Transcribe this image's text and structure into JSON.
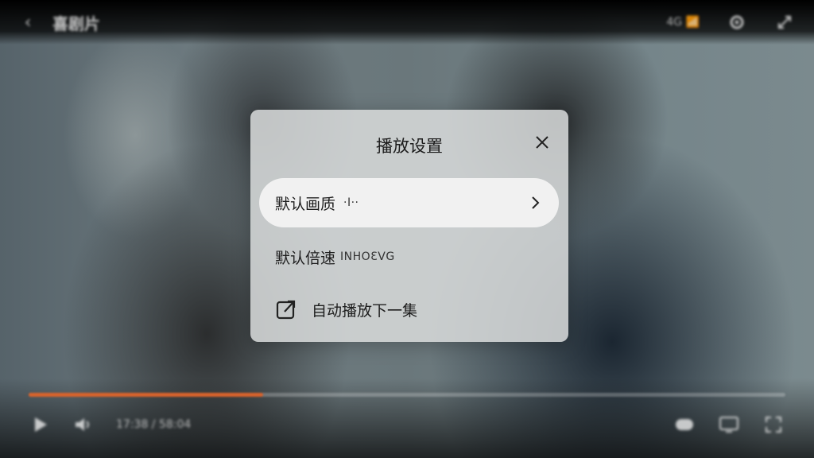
{
  "top_bar": {
    "title": "喜剧片",
    "status_text": "4G 📶"
  },
  "progress": {
    "played_fraction": 0.31
  },
  "controls": {
    "time_text": "17:38 / 58:04"
  },
  "dialog": {
    "title": "播放设置",
    "options": [
      {
        "label": "默认画质",
        "value": "·I··"
      },
      {
        "label": "默认倍速",
        "value": "INHOƐVG"
      },
      {
        "label": "自动播放下一集"
      }
    ]
  },
  "icons": {
    "back": "back-arrow-icon",
    "settings": "gear-icon",
    "fullscreen": "fullscreen-icon",
    "play": "play-icon",
    "volume": "volume-icon",
    "close": "close-icon",
    "chevron": "chevron-right-icon",
    "autoplay": "autoplay-icon"
  },
  "colors": {
    "progress_accent": "#d9632c",
    "dialog_background": "#d8dbdb"
  }
}
